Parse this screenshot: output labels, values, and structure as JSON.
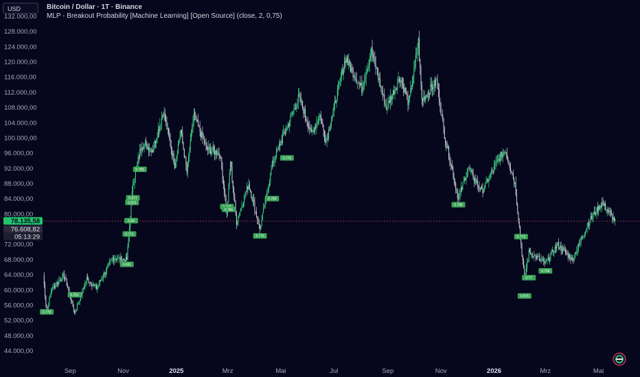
{
  "header": {
    "title": "Bitcoin / Dollar · 1T · Binance",
    "indicator": "MLP - Breakout Probability [Machine Learning] [Open Source] (close, 2, 0,75)",
    "currency": "USD"
  },
  "colors": {
    "background": "#06061c",
    "candle_up": "#3fdf8a",
    "candle_down": "#cfd3dc",
    "label_bg": "#3aa356",
    "price_tag": "#22c36a",
    "axis_text": "#a9a9bd",
    "price_line": "#8b4a3a"
  },
  "chart_data": {
    "type": "candlestick",
    "y_axis": {
      "min": 44000,
      "max": 132000,
      "step": 4000,
      "tick_labels": [
        "132.000,00",
        "128.000,00",
        "124.000,00",
        "120.000,00",
        "116.000,00",
        "112.000,00",
        "108.000,00",
        "104.000,00",
        "100.000,00",
        "96.000,00",
        "92.000,00",
        "88.000,00",
        "84.000,00",
        "80.000,00",
        "76.000,00",
        "72.000,00",
        "68.000,00",
        "64.000,00",
        "60.000,00",
        "56.000,00",
        "52.000,00",
        "48.000,00",
        "44.000,00"
      ]
    },
    "x_axis": {
      "labels": [
        {
          "text": "Sep",
          "date": "2024-09-01"
        },
        {
          "text": "Nov",
          "date": "2024-11-01"
        },
        {
          "text": "2025",
          "date": "2025-01-01",
          "bold": true
        },
        {
          "text": "Mrz",
          "date": "2025-03-01"
        },
        {
          "text": "Mai",
          "date": "2025-05-01"
        },
        {
          "text": "Jul",
          "date": "2025-07-01"
        },
        {
          "text": "Sep",
          "date": "2025-09-01"
        },
        {
          "text": "Nov",
          "date": "2025-11-01"
        },
        {
          "text": "2026",
          "date": "2026-01-01",
          "bold": true
        },
        {
          "text": "Mrz",
          "date": "2026-03-01"
        },
        {
          "text": "Mai",
          "date": "2026-05-01"
        }
      ],
      "start": "2024-08-01",
      "end": "2026-05-25"
    },
    "price_path": [
      [
        "2024-08-01",
        64000
      ],
      [
        "2024-08-05",
        54000
      ],
      [
        "2024-08-10",
        60000
      ],
      [
        "2024-08-25",
        64000
      ],
      [
        "2024-09-06",
        54000
      ],
      [
        "2024-09-20",
        63000
      ],
      [
        "2024-10-01",
        60500
      ],
      [
        "2024-10-20",
        68500
      ],
      [
        "2024-11-05",
        68000
      ],
      [
        "2024-11-12",
        88000
      ],
      [
        "2024-11-22",
        98500
      ],
      [
        "2024-12-05",
        97000
      ],
      [
        "2024-12-17",
        107000
      ],
      [
        "2024-12-30",
        93000
      ],
      [
        "2025-01-06",
        102000
      ],
      [
        "2025-01-13",
        91000
      ],
      [
        "2025-01-21",
        106000
      ],
      [
        "2025-02-05",
        97000
      ],
      [
        "2025-02-20",
        96000
      ],
      [
        "2025-02-28",
        80000
      ],
      [
        "2025-03-04",
        94000
      ],
      [
        "2025-03-11",
        78000
      ],
      [
        "2025-03-25",
        88000
      ],
      [
        "2025-04-07",
        76000
      ],
      [
        "2025-04-22",
        94000
      ],
      [
        "2025-05-10",
        104000
      ],
      [
        "2025-05-22",
        111000
      ],
      [
        "2025-06-05",
        101000
      ],
      [
        "2025-06-15",
        106000
      ],
      [
        "2025-06-22",
        99000
      ],
      [
        "2025-07-14",
        121000
      ],
      [
        "2025-08-02",
        113000
      ],
      [
        "2025-08-13",
        123000
      ],
      [
        "2025-08-30",
        108000
      ],
      [
        "2025-09-15",
        116000
      ],
      [
        "2025-09-25",
        109000
      ],
      [
        "2025-10-06",
        125500
      ],
      [
        "2025-10-10",
        110000
      ],
      [
        "2025-10-27",
        115000
      ],
      [
        "2025-11-05",
        101000
      ],
      [
        "2025-11-21",
        84000
      ],
      [
        "2025-12-02",
        92000
      ],
      [
        "2025-12-18",
        86000
      ],
      [
        "2026-01-05",
        94000
      ],
      [
        "2026-01-14",
        97000
      ],
      [
        "2026-01-25",
        88000
      ],
      [
        "2026-02-05",
        63000
      ],
      [
        "2026-02-10",
        70000
      ],
      [
        "2026-03-01",
        67000
      ],
      [
        "2026-03-15",
        72000
      ],
      [
        "2026-04-01",
        68000
      ],
      [
        "2026-04-20",
        78000
      ],
      [
        "2026-05-05",
        83000
      ],
      [
        "2026-05-20",
        78135.58
      ]
    ],
    "volatility_pct": 0.022,
    "probability_labels": [
      {
        "date": "2024-08-05",
        "price": 55000,
        "text": "0.779",
        "side": "below"
      },
      {
        "date": "2024-09-06",
        "price": 59500,
        "text": "0.761",
        "side": "below"
      },
      {
        "date": "2024-11-05",
        "price": 67500,
        "text": "0.691",
        "side": "below"
      },
      {
        "date": "2024-11-08",
        "price": 75500,
        "text": "0.771",
        "side": "below"
      },
      {
        "date": "2024-11-10",
        "price": 79000,
        "text": "0.84",
        "side": "below"
      },
      {
        "date": "2024-11-11",
        "price": 83800,
        "text": "0.823",
        "side": "below"
      },
      {
        "date": "2024-11-12",
        "price": 85000,
        "text": "0.871",
        "side": "below"
      },
      {
        "date": "2024-11-20",
        "price": 92500,
        "text": "0.765",
        "side": "below"
      },
      {
        "date": "2025-02-28",
        "price": 82700,
        "text": "0.738",
        "side": "below"
      },
      {
        "date": "2025-03-02",
        "price": 82000,
        "text": "0.765",
        "side": "below"
      },
      {
        "date": "2025-04-07",
        "price": 75000,
        "text": "0.776",
        "side": "below"
      },
      {
        "date": "2025-04-21",
        "price": 84800,
        "text": "0.783",
        "side": "below"
      },
      {
        "date": "2025-05-08",
        "price": 95500,
        "text": "0.776",
        "side": "below"
      },
      {
        "date": "2025-11-21",
        "price": 83200,
        "text": "0.786",
        "side": "below"
      },
      {
        "date": "2026-02-01",
        "price": 74800,
        "text": "0.773",
        "side": "below"
      },
      {
        "date": "2026-02-05",
        "price": 59200,
        "text": "0.816",
        "side": "below"
      },
      {
        "date": "2026-02-10",
        "price": 64000,
        "text": "0.77",
        "side": "below"
      },
      {
        "date": "2026-03-01",
        "price": 65800,
        "text": "0.759",
        "side": "below"
      }
    ],
    "current_price": {
      "value": 78135.58,
      "text": "78.135,58"
    },
    "price_labels": [
      {
        "text": "76.608,82"
      },
      {
        "text": "05:13:29"
      }
    ]
  }
}
